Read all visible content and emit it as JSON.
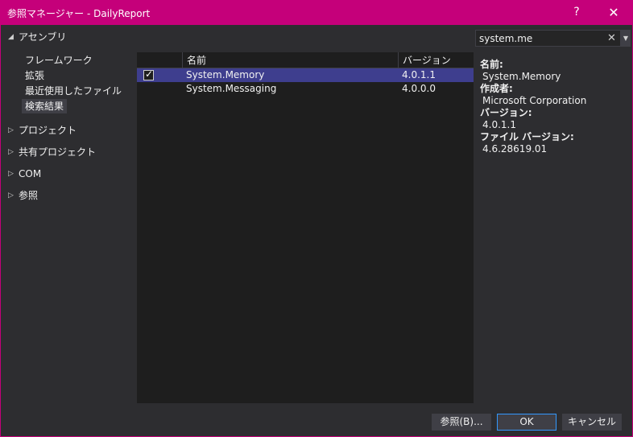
{
  "window": {
    "title": "参照マネージャー - DailyReport",
    "help": "?",
    "close": "✕"
  },
  "tree": {
    "assemblies": {
      "label": "アセンブリ",
      "children": [
        "フレームワーク",
        "拡張",
        "最近使用したファイル",
        "検索結果"
      ],
      "selected": "検索結果"
    },
    "others": [
      "プロジェクト",
      "共有プロジェクト",
      "COM",
      "参照"
    ]
  },
  "list": {
    "columns": {
      "name": "名前",
      "version": "バージョン"
    },
    "rows": [
      {
        "name": "System.Memory",
        "version": "4.0.1.1",
        "checked": true
      },
      {
        "name": "System.Messaging",
        "version": "4.0.0.0",
        "checked": false
      }
    ]
  },
  "search": {
    "value": "system.me",
    "clear": "✕"
  },
  "details": {
    "name_label": "名前:",
    "name_value": "System.Memory",
    "author_label": "作成者:",
    "author_value": "Microsoft Corporation",
    "version_label": "バージョン:",
    "version_value": "4.0.1.1",
    "file_version_label": "ファイル バージョン:",
    "file_version_value": "4.6.28619.01"
  },
  "buttons": {
    "browse": "参照(B)...",
    "ok": "OK",
    "cancel": "キャンセル"
  },
  "colors": {
    "title_bar": "#c5007a",
    "background": "#2d2d30",
    "list_bg": "#1e1e1e",
    "selected_row": "#3e3e8e"
  }
}
